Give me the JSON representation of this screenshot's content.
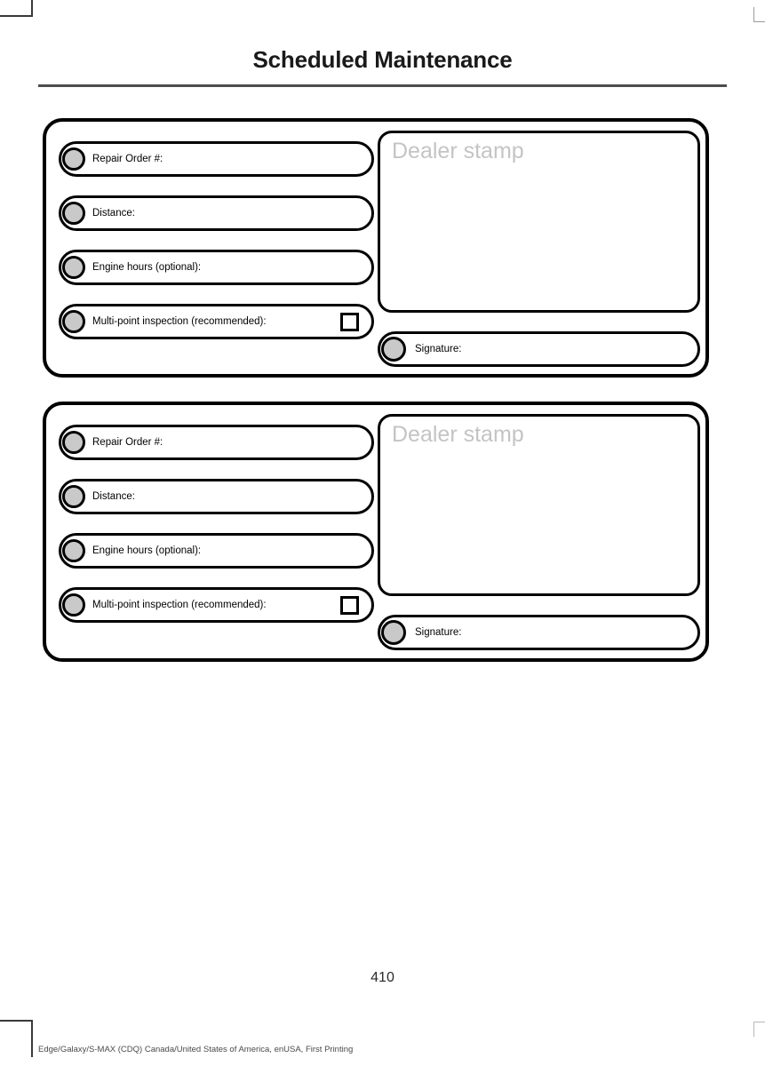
{
  "page": {
    "title": "Scheduled Maintenance",
    "number": "410",
    "footer": "Edge/Galaxy/S-MAX (CDQ) Canada/United States of America, enUSA, First Printing"
  },
  "colors": {
    "bullet_fill": "#c9c9c9",
    "stamp_placeholder": "#c4c4c4",
    "rule": "#4d4d4d",
    "border": "#000000"
  },
  "cards": [
    {
      "fields": [
        {
          "label": "Repair Order #:",
          "checkbox": false
        },
        {
          "label": "Distance:",
          "checkbox": false
        },
        {
          "label": "Engine hours (optional):",
          "checkbox": false
        },
        {
          "label": "Multi-point inspection (recommended):",
          "checkbox": true
        }
      ],
      "dealer_stamp_label": "Dealer stamp",
      "signature_label": "Signature:"
    },
    {
      "fields": [
        {
          "label": "Repair Order #:",
          "checkbox": false
        },
        {
          "label": "Distance:",
          "checkbox": false
        },
        {
          "label": "Engine hours (optional):",
          "checkbox": false
        },
        {
          "label": "Multi-point inspection (recommended):",
          "checkbox": true
        }
      ],
      "dealer_stamp_label": "Dealer stamp",
      "signature_label": "Signature:"
    }
  ]
}
